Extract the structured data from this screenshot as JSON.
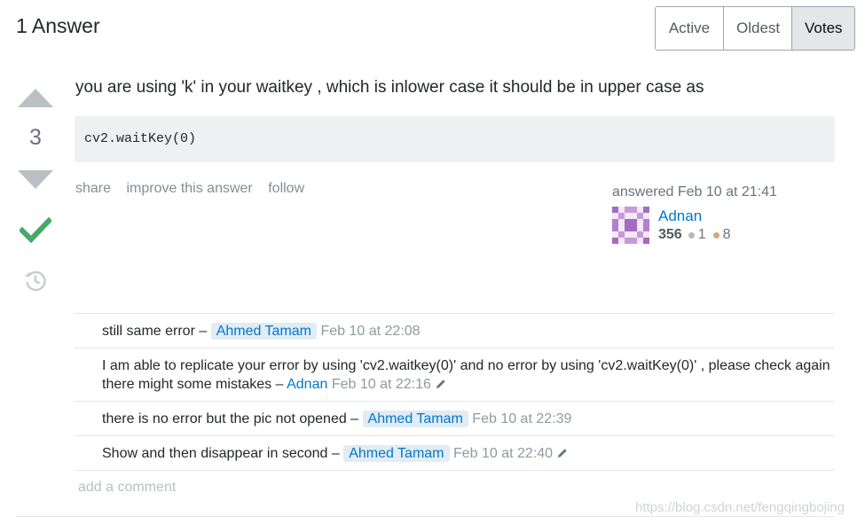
{
  "header": {
    "answers_count": "1 Answer",
    "sort_tabs": [
      {
        "label": "Active",
        "selected": false
      },
      {
        "label": "Oldest",
        "selected": false
      },
      {
        "label": "Votes",
        "selected": true
      }
    ]
  },
  "answer": {
    "score": "3",
    "accepted": true,
    "text": "you are using 'k' in your waitkey , which is inlower case it should be in upper case as",
    "code": "cv2.waitKey(0)",
    "menu": {
      "share": "share",
      "improve": "improve this answer",
      "follow": "follow"
    },
    "user_card": {
      "answered_time": "answered Feb 10 at 21:41",
      "name": "Adnan",
      "reputation": "356",
      "silver_badges": "1",
      "bronze_badges": "8"
    }
  },
  "comments": [
    {
      "text": "still same error",
      "separator": " – ",
      "user": "Ahmed Tamam",
      "is_op": true,
      "date": "Feb 10 at 22:08",
      "edited": false
    },
    {
      "text": "I am able to replicate your error by using 'cv2.waitkey(0)' and no error by using 'cv2.waitKey(0)' , please check again there might some mistakes",
      "separator": " – ",
      "user": "Adnan",
      "is_op": false,
      "date": "Feb 10 at 22:16",
      "edited": true
    },
    {
      "text": "there is no error but the pic not opened",
      "separator": " – ",
      "user": "Ahmed Tamam",
      "is_op": true,
      "date": "Feb 10 at 22:39",
      "edited": false
    },
    {
      "text": "Show and then disappear in second",
      "separator": " – ",
      "user": "Ahmed Tamam",
      "is_op": true,
      "date": "Feb 10 at 22:40",
      "edited": true
    }
  ],
  "add_comment": "add a comment",
  "watermark": "https://blog.csdn.net/fengqingbojing",
  "colors": {
    "link": "#0077cc",
    "accepted": "#48a868",
    "vote_arrow": "#bbc0c4",
    "op_highlight": "#e1ecf4"
  },
  "icons": {
    "upvote": "triangle-up",
    "downvote": "triangle-down",
    "accepted": "checkmark-icon",
    "history": "history-icon",
    "edit": "pencil-icon"
  }
}
